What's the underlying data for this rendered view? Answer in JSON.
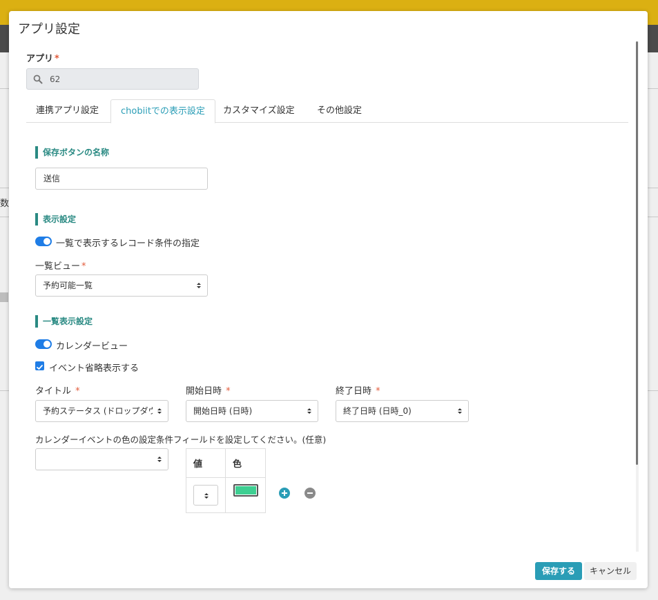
{
  "background": {
    "left_glyph": "数"
  },
  "dialog": {
    "title": "アプリ設定"
  },
  "app_field": {
    "label": "アプリ",
    "required_mark": "*",
    "value": "62"
  },
  "tabs": [
    {
      "label": "連携アプリ設定",
      "active": false
    },
    {
      "label": "chobiitでの表示設定",
      "active": true
    },
    {
      "label": "カスタマイズ設定",
      "active": false
    },
    {
      "label": "その他設定",
      "active": false
    }
  ],
  "save_button_section": {
    "title": "保存ボタンの名称",
    "input_value": "送信"
  },
  "display_section": {
    "title": "表示設定",
    "record_condition_toggle_label": "一覧で表示するレコード条件の指定",
    "record_condition_toggle_on": true,
    "list_view_label": "一覧ビュー",
    "list_view_required": "*",
    "list_view_value": "予約可能一覧"
  },
  "list_display_section": {
    "title": "一覧表示設定",
    "calendar_toggle_label": "カレンダービュー",
    "calendar_toggle_on": true,
    "event_abbrev_label": "イベント省略表示する",
    "event_abbrev_checked": true,
    "title_label": "タイトル",
    "title_required": "*",
    "title_value": "予約ステータス (ドロップダウン)",
    "start_label": "開始日時",
    "start_required": "*",
    "start_value": "開始日時 (日時)",
    "end_label": "終了日時",
    "end_required": "*",
    "end_value": "終了日時 (日時_0)",
    "color_condition_label": "カレンダーイベントの色の設定条件フィールドを設定してください。(任意)",
    "color_condition_value": "",
    "color_table": {
      "col_value": "値",
      "col_color": "色",
      "row_color": "#3ecf92"
    }
  },
  "footer": {
    "save_label": "保存する",
    "cancel_label": "キャンセル"
  },
  "colors": {
    "accent": "#2a9db6",
    "section": "#2a8a83",
    "toggle": "#1f7de6",
    "required": "#e25b3b",
    "topbar": "#dbb012"
  }
}
